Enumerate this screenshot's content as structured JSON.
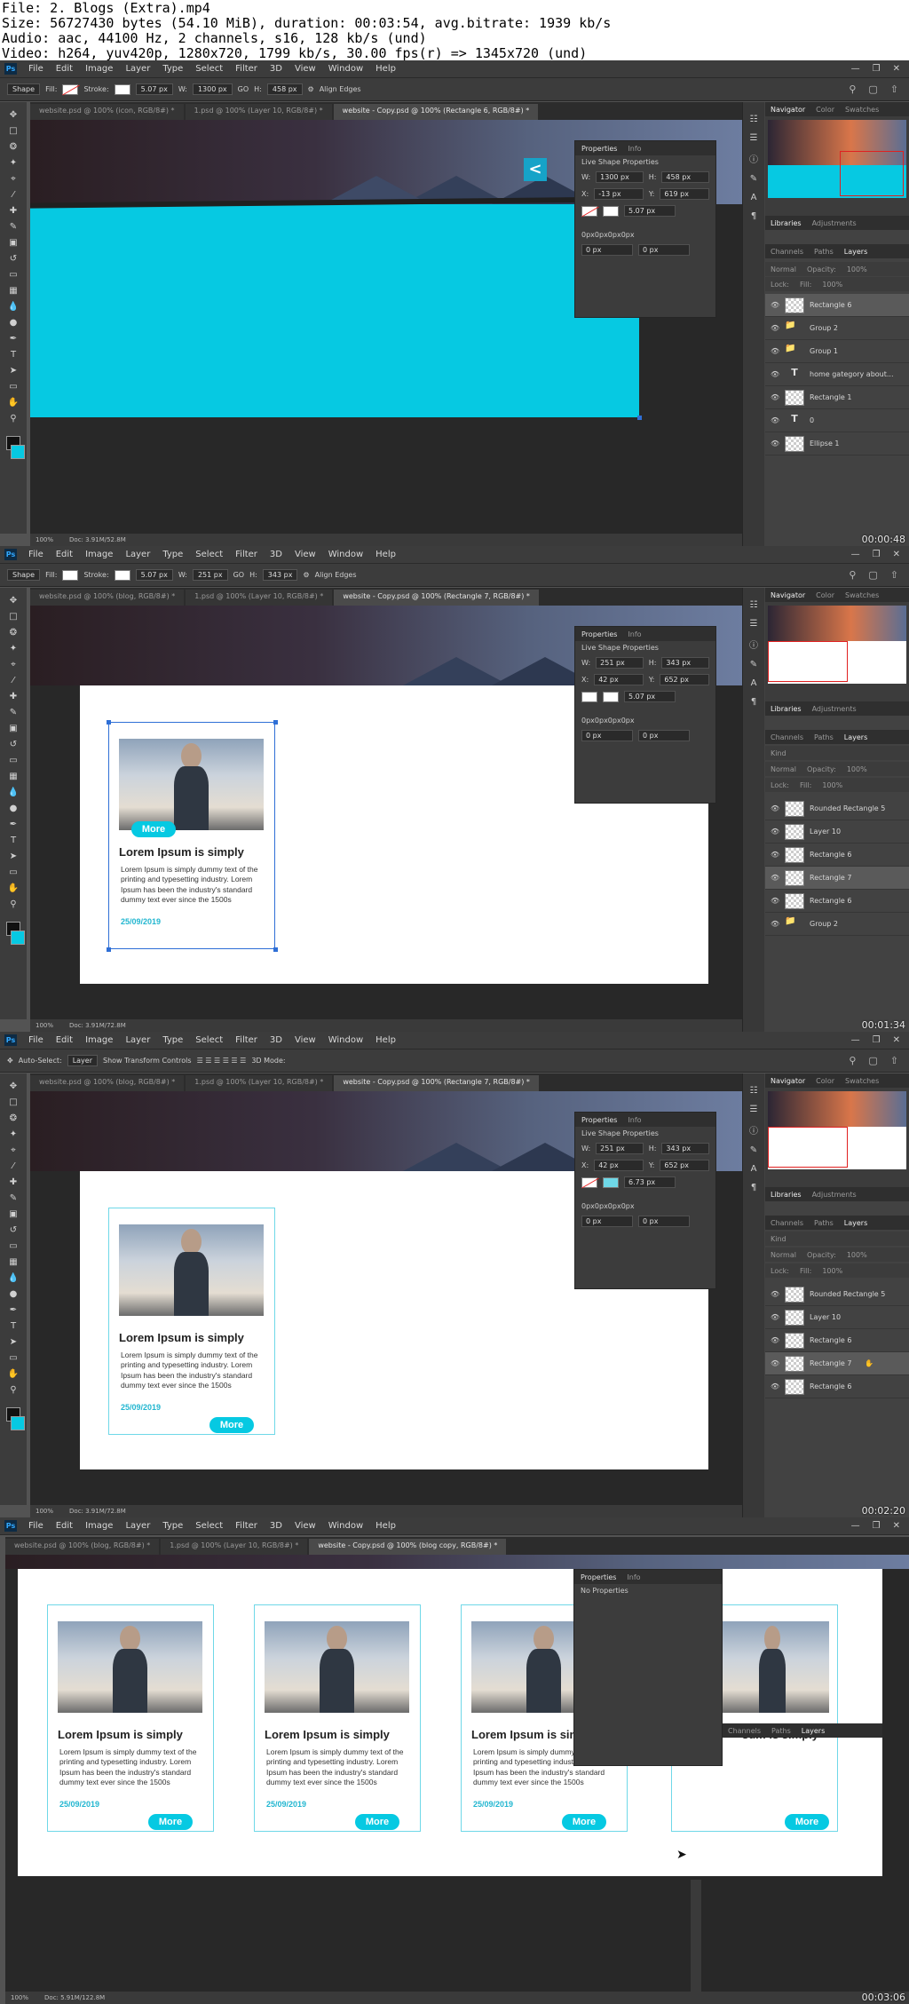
{
  "file_info": {
    "line1": "File: 2. Blogs (Extra).mp4",
    "line2": "Size: 56727430 bytes (54.10 MiB), duration: 00:03:54, avg.bitrate: 1939 kb/s",
    "line3": "Audio: aac, 44100 Hz, 2 channels, s16, 128 kb/s (und)",
    "line4": "Video: h264, yuv420p, 1280x720, 1799 kb/s, 30.00 fps(r) => 1345x720 (und)"
  },
  "menu": [
    "File",
    "Edit",
    "Image",
    "Layer",
    "Type",
    "Select",
    "Filter",
    "3D",
    "View",
    "Window",
    "Help"
  ],
  "frames": [
    {
      "timestamp": "00:00:48",
      "tool_mode": "Shape",
      "options": {
        "fill_label": "Fill:",
        "stroke_label": "Stroke:",
        "stroke_width": "5.07 px",
        "w_label": "W:",
        "w": "1300 px",
        "link": "GO",
        "h_label": "H:",
        "h": "458 px",
        "align_edges": "Align Edges"
      },
      "tabs": [
        "website.psd @ 100% (icon, RGB/8#) *",
        "1.psd @ 100% (Layer 10, RGB/8#) *",
        "website - Copy.psd @ 100% (Rectangle 6, RGB/8#) *"
      ],
      "props": {
        "tab1": "Properties",
        "tab2": "Info",
        "title": "Live Shape Properties",
        "w": "1300 px",
        "h": "458 px",
        "x": "-13 px",
        "y": "619 px",
        "stroke": "5.07 px",
        "corners": "0px0px0px0px",
        "r1": "0 px",
        "r2": "0 px"
      },
      "status": {
        "zoom": "100%",
        "doc": "Doc: 3.91M/52.8M"
      },
      "layers": [
        {
          "name": "Rectangle 6",
          "kind": "shape",
          "selected": true
        },
        {
          "name": "Group 2",
          "kind": "folder"
        },
        {
          "name": "Group 1",
          "kind": "folder"
        },
        {
          "name": "home    gategory    about...",
          "kind": "text"
        },
        {
          "name": "Rectangle 1",
          "kind": "shape"
        },
        {
          "name": "0",
          "kind": "text"
        },
        {
          "name": "Ellipse 1",
          "kind": "shape"
        }
      ]
    },
    {
      "timestamp": "00:01:34",
      "tool_mode": "Shape",
      "options": {
        "fill_label": "Fill:",
        "stroke_label": "Stroke:",
        "stroke_width": "5.07 px",
        "w_label": "W:",
        "w": "251 px",
        "link": "GO",
        "h_label": "H:",
        "h": "343 px",
        "align_edges": "Align Edges"
      },
      "tabs": [
        "website.psd @ 100% (blog, RGB/8#) *",
        "1.psd @ 100% (Layer 10, RGB/8#) *",
        "website - Copy.psd @ 100% (Rectangle 7, RGB/8#) *"
      ],
      "props": {
        "tab1": "Properties",
        "tab2": "Info",
        "title": "Live Shape Properties",
        "w": "251 px",
        "h": "343 px",
        "x": "42 px",
        "y": "652 px",
        "stroke": "5.07 px",
        "corners": "0px0px0px0px",
        "r1": "0 px",
        "r2": "0 px"
      },
      "status": {
        "zoom": "100%",
        "doc": "Doc: 3.91M/72.8M"
      },
      "card": {
        "title": "Lorem Ipsum is simply",
        "text": "Lorem Ipsum is simply dummy text of the printing and typesetting industry. Lorem Ipsum has been the industry's standard dummy text ever since the 1500s",
        "date": "25/09/2019",
        "more": "More"
      },
      "layers": [
        {
          "name": "Rounded Rectangle 5",
          "kind": "shape"
        },
        {
          "name": "Layer 10",
          "kind": "shape"
        },
        {
          "name": "Rectangle 6",
          "kind": "shape"
        },
        {
          "name": "Rectangle 7",
          "kind": "shape",
          "selected": true
        },
        {
          "name": "Rectangle 6",
          "kind": "shape"
        },
        {
          "name": "Group 2",
          "kind": "folder"
        }
      ]
    },
    {
      "timestamp": "00:02:20",
      "tool_mode": "Shape",
      "options": {
        "auto_select": "Auto-Select:",
        "layer": "Layer",
        "transform": "Show Transform Controls",
        "mode_3d": "3D Mode:"
      },
      "tabs": [
        "website.psd @ 100% (blog, RGB/8#) *",
        "1.psd @ 100% (Layer 10, RGB/8#) *",
        "website - Copy.psd @ 100% (Rectangle 7, RGB/8#) *"
      ],
      "props": {
        "tab1": "Properties",
        "tab2": "Info",
        "title": "Live Shape Properties",
        "w": "251 px",
        "h": "343 px",
        "x": "42 px",
        "y": "652 px",
        "stroke": "6.73 px",
        "corners": "0px0px0px0px",
        "r1": "0 px",
        "r2": "0 px"
      },
      "status": {
        "zoom": "100%",
        "doc": "Doc: 3.91M/72.8M"
      },
      "card": {
        "title": "Lorem Ipsum is simply",
        "text": "Lorem Ipsum is simply dummy text of the printing and typesetting industry. Lorem Ipsum has been the industry's standard dummy text ever since the 1500s",
        "date": "25/09/2019",
        "more": "More"
      },
      "layers": [
        {
          "name": "Rounded Rectangle 5",
          "kind": "shape"
        },
        {
          "name": "Layer 10",
          "kind": "shape"
        },
        {
          "name": "Rectangle 6",
          "kind": "shape"
        },
        {
          "name": "Rectangle 7",
          "kind": "shape",
          "selected": true
        },
        {
          "name": "Rectangle 6",
          "kind": "shape"
        }
      ]
    },
    {
      "timestamp": "00:03:06",
      "tabs": [
        "website.psd @ 100% (blog, RGB/8#) *",
        "1.psd @ 100% (Layer 10, RGB/8#) *",
        "website - Copy.psd @ 100% (blog copy, RGB/8#) *"
      ],
      "props": {
        "tab1": "Properties",
        "tab2": "Info",
        "no_props": "No Properties"
      },
      "status": {
        "zoom": "100%",
        "doc": "Doc: 5.91M/122.8M"
      },
      "card": {
        "title": "Lorem Ipsum is simply",
        "title_cut": "sum is simply",
        "text": "Lorem Ipsum is simply dummy text of the printing and typesetting industry. Lorem Ipsum has been the industry's standard dummy text ever since the 1500s",
        "date": "25/09/2019",
        "more": "More"
      },
      "dock_tabs": [
        "Channels",
        "Paths",
        "Layers"
      ]
    }
  ],
  "panels": {
    "navigator": "Navigator",
    "color": "Color",
    "swatches": "Swatches",
    "libraries": "Libraries",
    "adjustments": "Adjustments",
    "channels": "Channels",
    "paths": "Paths",
    "layers": "Layers",
    "kind": "Kind",
    "normal": "Normal",
    "opacity": "Opacity:",
    "opacity_val": "100%",
    "fill": "Fill:",
    "fill_val": "100%",
    "lock": "Lock:"
  },
  "colors": {
    "accent": "#06c9e2",
    "ps_bg": "#535353",
    "panel": "#3c3c3c"
  }
}
